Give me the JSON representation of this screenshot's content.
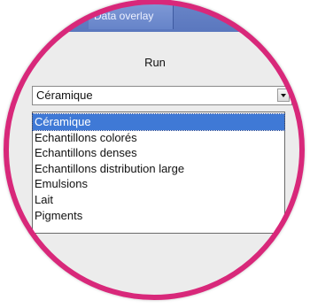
{
  "tabs": [
    {
      "label": "Data overlay"
    }
  ],
  "toolbar": {
    "run_label": "Run"
  },
  "combo": {
    "selected": "Céramique"
  },
  "dropdown": {
    "options": [
      {
        "label": "Céramique"
      },
      {
        "label": "Echantillons colorés"
      },
      {
        "label": "Echantillons denses"
      },
      {
        "label": "Echantillons distribution large"
      },
      {
        "label": "Emulsions"
      },
      {
        "label": "Lait"
      },
      {
        "label": "Pigments"
      }
    ],
    "highlighted_index": 0
  },
  "colors": {
    "frame_ring": "#d8287a",
    "tab_bar": "#5a77be",
    "selection": "#3f79d6"
  }
}
